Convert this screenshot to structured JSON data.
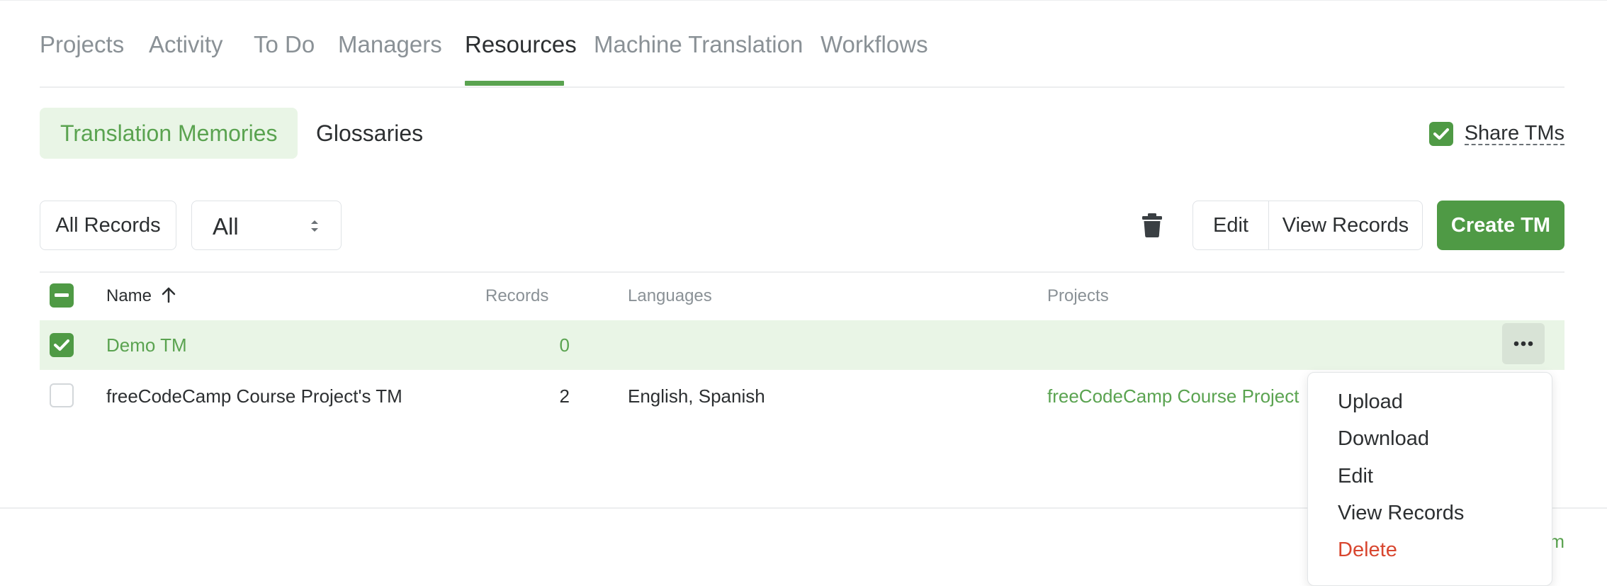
{
  "tabs": [
    {
      "label": "Projects"
    },
    {
      "label": "Activity"
    },
    {
      "label": "To Do"
    },
    {
      "label": "Managers"
    },
    {
      "label": "Resources",
      "active": true
    },
    {
      "label": "Machine Translation"
    },
    {
      "label": "Workflows"
    }
  ],
  "subtabs": {
    "translation_memories": "Translation Memories",
    "glossaries": "Glossaries"
  },
  "share_tms": {
    "label": "Share TMs",
    "checked": true
  },
  "toolbar": {
    "all_records": "All Records",
    "filter_value": "All",
    "edit": "Edit",
    "view_records": "View Records",
    "create_tm": "Create TM"
  },
  "table": {
    "columns": {
      "name": "Name",
      "records": "Records",
      "languages": "Languages",
      "projects": "Projects"
    },
    "rows": [
      {
        "name": "Demo TM",
        "records": "0",
        "languages": "",
        "projects": "",
        "selected": true
      },
      {
        "name": "freeCodeCamp Course Project's TM",
        "records": "2",
        "languages": "English, Spanish",
        "projects": "freeCodeCamp Course Project",
        "selected": false
      }
    ]
  },
  "menu": {
    "upload": "Upload",
    "download": "Download",
    "edit": "Edit",
    "view_records": "View Records",
    "delete": "Delete"
  },
  "footer": {
    "link_text": "m"
  },
  "colors": {
    "accent": "#4f9a45",
    "accent_light": "#e9f5e6",
    "danger": "#d8462f",
    "muted": "#8a9196"
  }
}
